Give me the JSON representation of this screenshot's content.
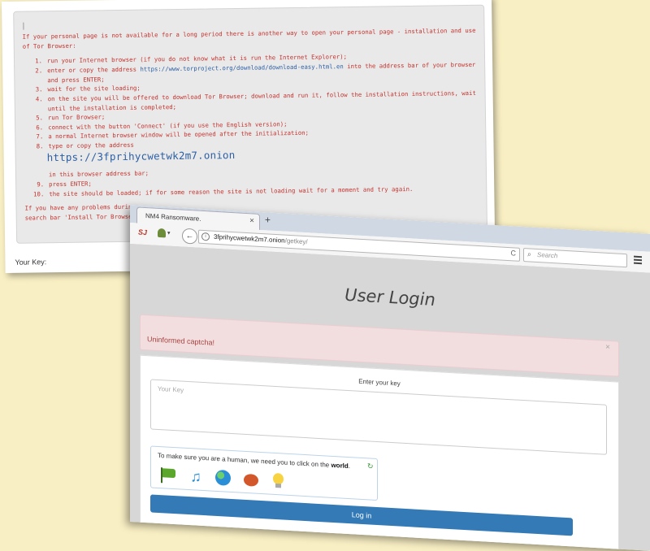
{
  "note": {
    "intro": "If your personal page is not available for a long period there is another way to open your personal page - installation and use\nof Tor Browser:",
    "steps": [
      {
        "num": "1.",
        "text": "run your Internet browser (if you do not know what it is run the Internet Explorer);"
      },
      {
        "num": "2.",
        "pre": "enter or copy the address ",
        "link": "https://www.torproject.org/download/download-easy.html.en",
        "post": " into the address bar of your browser and press ENTER;"
      },
      {
        "num": "3.",
        "text": "wait for the site loading;"
      },
      {
        "num": "4.",
        "text": "on the site you will be offered to download Tor Browser; download and run it, follow the installation instructions, wait until the installation is completed;"
      },
      {
        "num": "5.",
        "text": "run Tor Browser;"
      },
      {
        "num": "6.",
        "text": "connect with the button 'Connect' (if you use the English version);"
      },
      {
        "num": "7.",
        "text": "a normal Internet browser window will be opened after the initialization;"
      },
      {
        "num": "8.",
        "text": "type or copy the address"
      }
    ],
    "onion_address": "https://3fprihycwetwk2m7.onion",
    "after_address": "in this browser address bar;",
    "steps_after": [
      {
        "num": "9.",
        "text": "press ENTER;"
      },
      {
        "num": "10.",
        "text": "the site should be loaded; if for some reason the site is not loading wait for a moment and try again."
      }
    ],
    "footer_line1": "If you have any problems during",
    "footer_line2": "search bar 'Install Tor Browser",
    "key_label": "Your Key:"
  },
  "browser": {
    "tab_title": "NM4 Ransomware.",
    "tab_close": "×",
    "new_tab": "+",
    "logo_text": "SJ",
    "url_host": "3fprihycwetwk2m7.onion",
    "url_path": "/getkey/",
    "search_placeholder": "Search",
    "back_glyph": "←",
    "reload_glyph": "C",
    "info_glyph": "i",
    "dropdown_glyph": "▾",
    "search_glyph": "⌕"
  },
  "login": {
    "title": "User Login",
    "alert_text": "Uninformed captcha!",
    "alert_close": "×",
    "key_caption": "Enter your key",
    "key_placeholder": "Your Key",
    "captcha_prompt": "To make sure you are a human, we need you to click on the ",
    "captcha_target": "world",
    "captcha_period": ".",
    "refresh_glyph": "↻",
    "icons": [
      "flag-icon",
      "music-icon",
      "world-icon",
      "bug-icon",
      "bulb-icon"
    ],
    "music_glyph": "♫",
    "button_label": "Log in"
  }
}
